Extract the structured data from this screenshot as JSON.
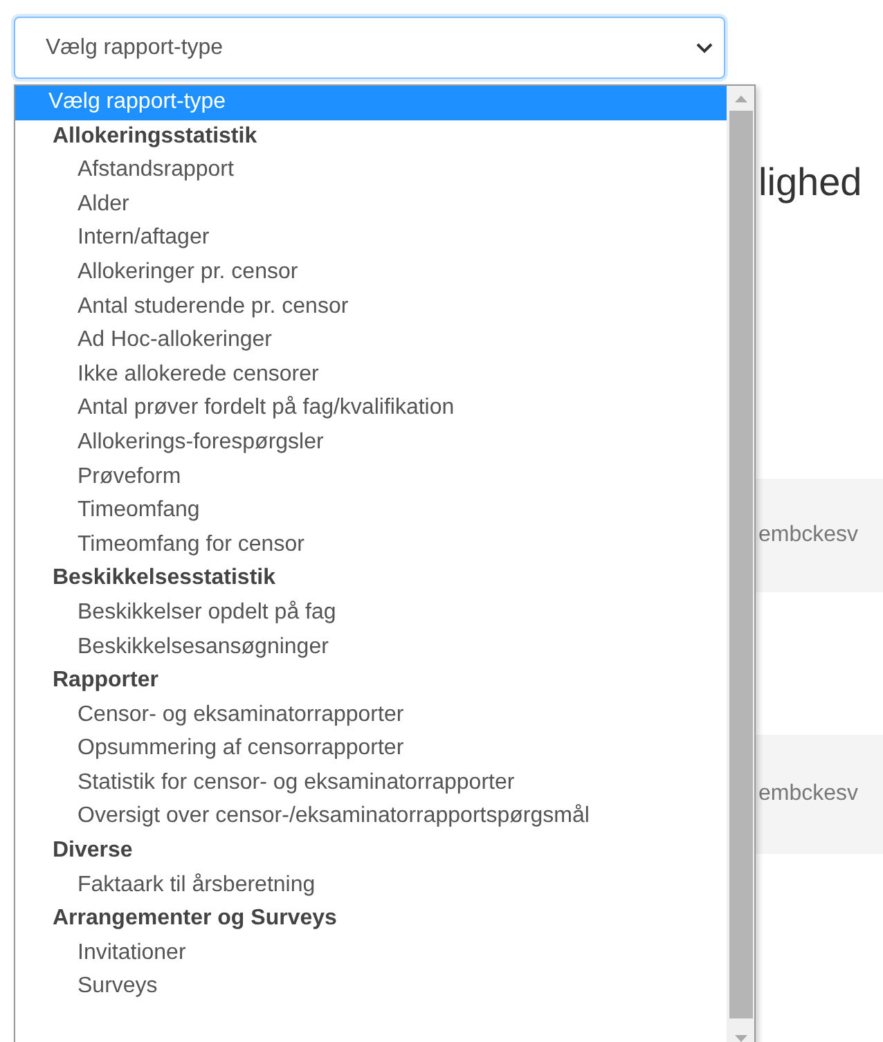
{
  "report_type_select": {
    "value": "Vælg rapport-type"
  },
  "dropdown": {
    "items": [
      {
        "kind": "option",
        "label": "Vælg rapport-type",
        "selected": true
      },
      {
        "kind": "group",
        "label": "Allokeringsstatistik",
        "children": [
          {
            "label": "Afstandsrapport",
            "selected": false
          },
          {
            "label": "Alder",
            "selected": false
          },
          {
            "label": "Intern/aftager",
            "selected": false
          },
          {
            "label": "Allokeringer pr. censor",
            "selected": false
          },
          {
            "label": "Antal studerende pr. censor",
            "selected": false
          },
          {
            "label": "Ad Hoc-allokeringer",
            "selected": false
          },
          {
            "label": "Ikke allokerede censorer",
            "selected": false
          },
          {
            "label": "Antal prøver fordelt på fag/kvalifikation",
            "selected": false
          },
          {
            "label": "Allokerings-forespørgsler",
            "selected": false
          },
          {
            "label": "Prøveform",
            "selected": false
          },
          {
            "label": "Timeomfang",
            "selected": false
          },
          {
            "label": "Timeomfang for censor",
            "selected": false
          }
        ]
      },
      {
        "kind": "group",
        "label": "Beskikkelsesstatistik",
        "children": [
          {
            "label": "Beskikkelser opdelt på fag",
            "selected": false
          },
          {
            "label": "Beskikkelsesansøgninger",
            "selected": false
          }
        ]
      },
      {
        "kind": "group",
        "label": "Rapporter",
        "children": [
          {
            "label": "Censor- og eksaminatorrapporter",
            "selected": false
          },
          {
            "label": "Opsummering af censorrapporter",
            "selected": false
          },
          {
            "label": "Statistik for censor- og eksaminatorrapporter",
            "selected": false
          },
          {
            "label": "Oversigt over censor-/eksaminatorrapportspørgsmål",
            "selected": false
          }
        ]
      },
      {
        "kind": "group",
        "label": "Diverse",
        "children": [
          {
            "label": "Faktaark til årsberetning",
            "selected": false
          }
        ]
      },
      {
        "kind": "group",
        "label": "Arrangementer og Surveys",
        "children": [
          {
            "label": "Invitationer",
            "selected": false
          },
          {
            "label": "Surveys",
            "selected": false
          }
        ]
      }
    ]
  },
  "background": {
    "heading": "lighed",
    "panels": [
      {
        "text": "embckesv"
      },
      {
        "text": "embckesv"
      }
    ]
  }
}
